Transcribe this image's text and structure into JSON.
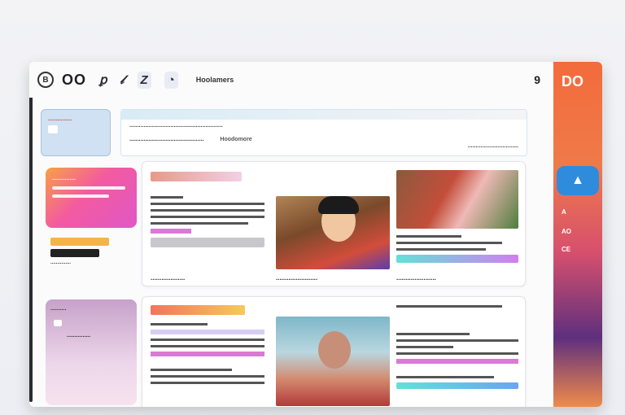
{
  "top": {
    "brand": "OO",
    "tab_z": "Z",
    "title": "Hoolamers",
    "right_num": "9"
  },
  "rightbar": {
    "brand": "DO",
    "items": [
      "A",
      "AO",
      "CE"
    ]
  },
  "header": {
    "line1": "...........................................................",
    "left": "...............................................",
    "middle": "Hoodomore",
    "right": "................................"
  },
  "left_cards": {
    "blue_title": "...............",
    "pink_title": "...............",
    "stack": [
      "...............",
      "...............",
      "..............."
    ],
    "lilac_title": "..........",
    "lilac_item": "..............."
  },
  "posts": [
    {
      "caption": "...................",
      "photo_caption": ".......................",
      "right_caption": "......................"
    },
    {
      "caption": "...................",
      "photo_caption": ".......................",
      "right_caption": "......................"
    }
  ],
  "colors": {
    "accent": "#f36b3c",
    "pink": "#f35aa0",
    "blue": "#2f8bdc",
    "cyan": "#3fd6e0",
    "lilac": "#c7a1c9"
  }
}
